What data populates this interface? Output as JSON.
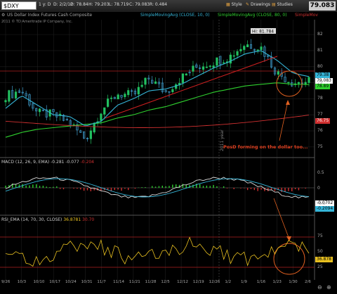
{
  "toolbar": {
    "symbol": "$DXY",
    "period": "1 y: D",
    "date": "D: 2/2/12",
    "open": "O: 78.84",
    "high": "H: 79.203",
    "low": "L: 78.719",
    "close": "C: 79.083",
    "range": "R: 0.484",
    "last_price": "79.083",
    "style_label": "Style",
    "drawings_label": "Drawings",
    "studies_label": "Studies"
  },
  "studybar": {
    "chart_title": "US Dollar Index Futures Cash Composite",
    "sma1": "SimpleMovingAvg (CLOSE, 10, 0)",
    "sma2": "SimpleMovingAvg (CLOSE, 80, 0)",
    "sma3": "SimpleMov"
  },
  "copyright": "2011 © TD Ameritrade IP Company, Inc.",
  "hi_label": "Hi: 81.784",
  "year_marker": "2011 year",
  "annotation": "PosD forming on the dollar too...",
  "macd": {
    "label": "MACD (12, 26, 9, EMA)",
    "value1": "-0.281",
    "value2": "-0.077",
    "value3": "-0.204"
  },
  "rsi": {
    "label": "RSI_EMA (14, 70, 30, CLOSE)",
    "value1": "36.8781",
    "value2": "30.70"
  },
  "price_tags": {
    "sma10": "79.38",
    "close": "79.083",
    "sma80": "78.89",
    "sma200": "76.75",
    "macd1": "-0.0702",
    "macd2": "-0.2094",
    "rsi": "36.878"
  },
  "y_axis": [
    "82",
    "81",
    "80",
    "79",
    "78",
    "77",
    "76",
    "75"
  ],
  "macd_axis": [
    "0.5",
    "0",
    "-0.5"
  ],
  "rsi_axis": [
    "75",
    "50",
    "25"
  ],
  "x_axis": [
    "9/26",
    "10/3",
    "10/10",
    "10/17",
    "10/24",
    "10/31",
    "11/7",
    "11/14",
    "11/21",
    "11/28",
    "12/5",
    "12/12",
    "12/19",
    "12/26",
    "1/2",
    "1/9",
    "1/16",
    "1/23",
    "1/30",
    "2/6"
  ],
  "colors": {
    "background": "#000000",
    "candle_up": "#22c060",
    "candle_down": "#40a0d0",
    "sma10": "#35b5d8",
    "sma80": "#2fd02f",
    "sma200": "#d03030",
    "trendline": "#d02020",
    "annotation": "#e04020",
    "rsi_line": "#e8c020"
  },
  "chart_data": {
    "type": "line",
    "title": "US Dollar Index Futures Cash Composite",
    "x": [
      "9/26",
      "10/3",
      "10/10",
      "10/17",
      "10/24",
      "10/31",
      "11/7",
      "11/14",
      "11/21",
      "11/28",
      "12/5",
      "12/12",
      "12/19",
      "12/26",
      "1/2",
      "1/9",
      "1/16",
      "1/23",
      "1/30",
      "2/2"
    ],
    "series": [
      {
        "name": "$DXY",
        "values": [
          78.2,
          78.5,
          77.1,
          77.0,
          76.5,
          75.5,
          77.3,
          78.3,
          78.2,
          79.3,
          78.4,
          79.3,
          80.0,
          80.3,
          80.6,
          81.4,
          81.2,
          79.6,
          79.0,
          79.08
        ]
      },
      {
        "name": "SimpleMovingAvg (CLOSE, 10, 0)",
        "values": [
          77.4,
          78.2,
          77.6,
          77.0,
          76.9,
          76.3,
          76.6,
          77.6,
          78.0,
          78.5,
          78.6,
          78.9,
          79.4,
          79.9,
          80.3,
          80.8,
          81.0,
          80.4,
          79.6,
          79.38
        ]
      },
      {
        "name": "SimpleMovingAvg (CLOSE, 80, 0)",
        "values": [
          75.6,
          75.9,
          76.1,
          76.2,
          76.3,
          76.4,
          76.5,
          76.8,
          77.0,
          77.3,
          77.5,
          77.8,
          78.1,
          78.4,
          78.6,
          78.8,
          78.9,
          79.0,
          78.9,
          78.89
        ]
      }
    ],
    "ylim": [
      74.6,
      82.4
    ],
    "hi": 81.784,
    "grid": true
  }
}
